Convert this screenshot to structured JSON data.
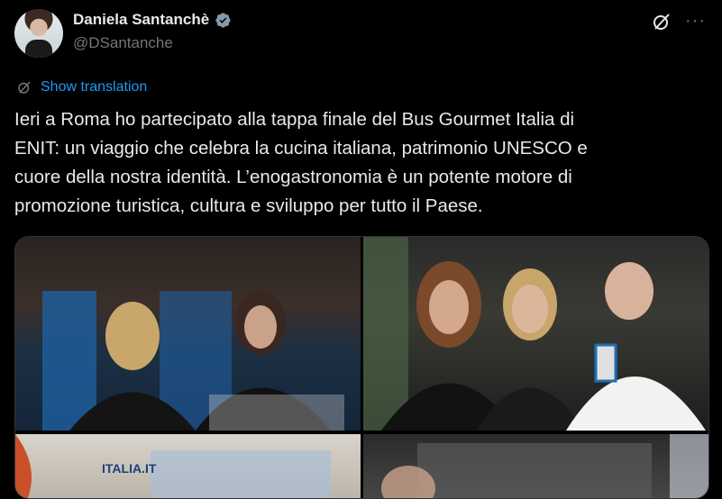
{
  "author": {
    "name": "Daniela Santanchè",
    "handle": "@DSantanche"
  },
  "icons": {
    "verified": "verified-badge-icon",
    "grok": "grok-icon",
    "more": "more-icon",
    "translate": "translate-icon"
  },
  "colors": {
    "background": "#000000",
    "link": "#1d9bf0",
    "text": "#e7e9ea",
    "muted": "#71767b"
  },
  "header": {
    "more_label": "···"
  },
  "translation": {
    "label": "Show translation"
  },
  "tweet": {
    "text": "Ieri a Roma ho partecipato alla tappa finale del Bus Gourmet Italia di\nENIT: un viaggio che celebra la cucina italiana, patrimonio UNESCO e\ncuore della nostra identità. L’enogastronomia è un potente motore di\npromozione turistica, cultura e sviluppo per tutto il Paese."
  },
  "media": {
    "photo3_sign": "ITALIA.IT"
  }
}
